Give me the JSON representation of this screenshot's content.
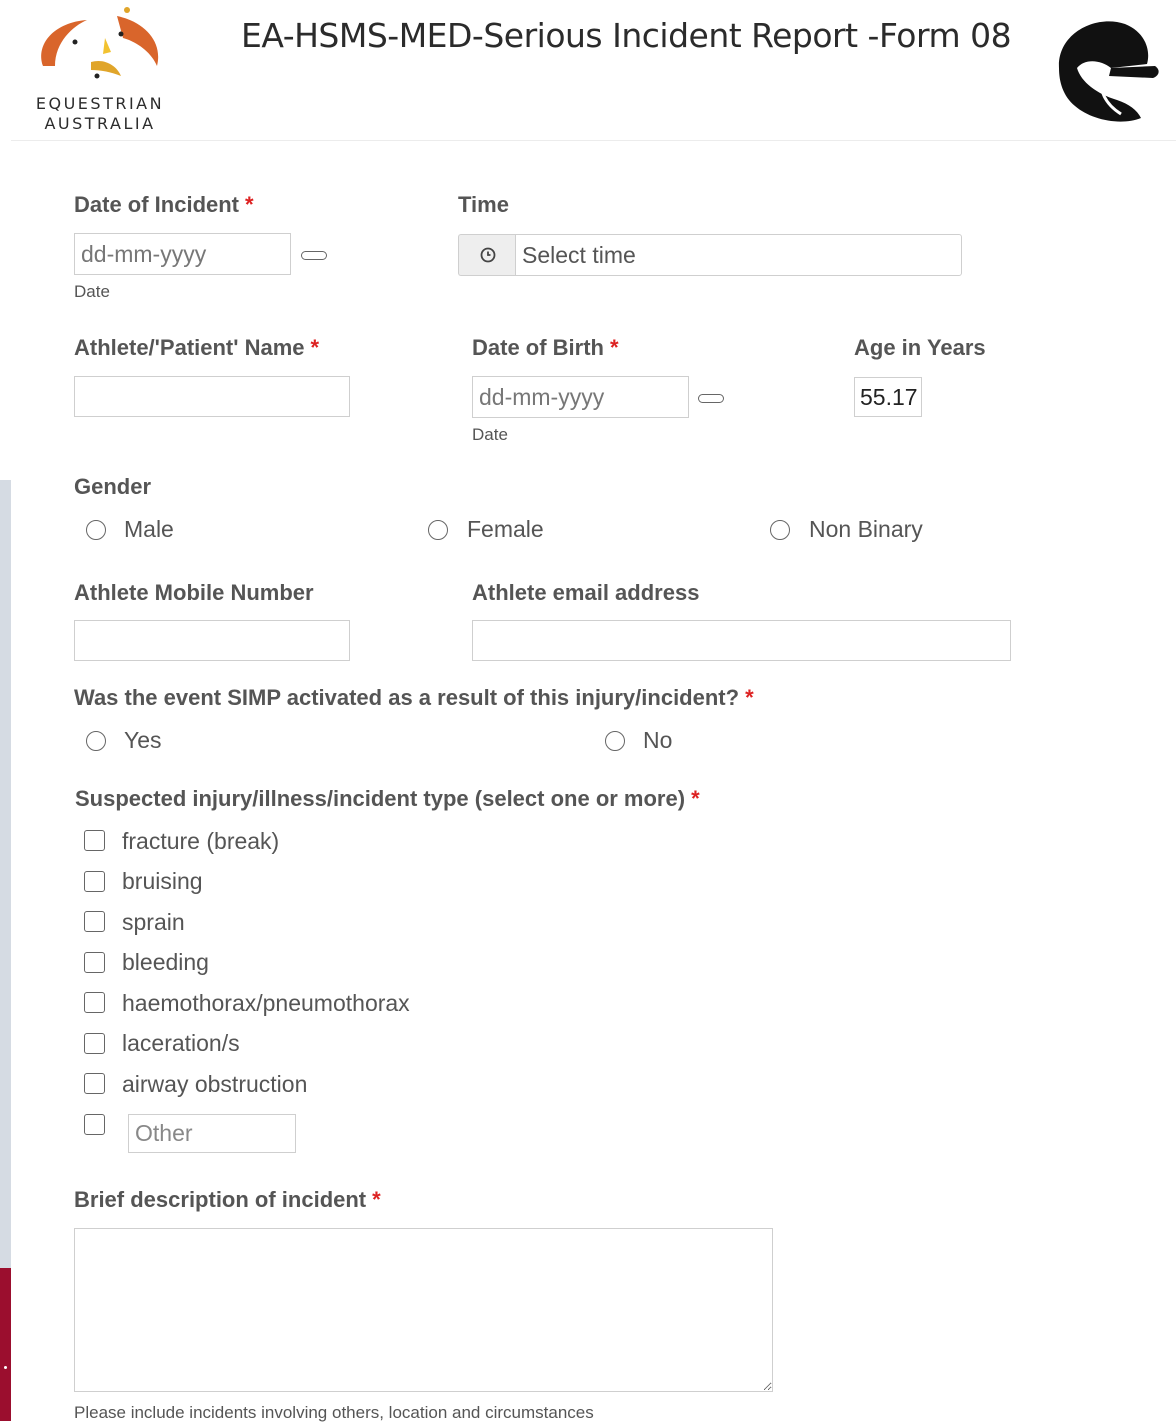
{
  "header": {
    "logo_line1": "EQUESTRIAN",
    "logo_line2": "AUSTRALIA",
    "title": "EA-HSMS-MED-Serious Incident Report  -Form 08"
  },
  "colors": {
    "required": "#dd2222",
    "brand_red": "#9b0e2e",
    "logo_orange": "#d9652b",
    "logo_yellow": "#f2c230"
  },
  "fields": {
    "date_of_incident": {
      "label": "Date of Incident",
      "placeholder": "dd-mm-yyyy",
      "hint": "Date"
    },
    "time": {
      "label": "Time",
      "placeholder": "Select time",
      "icon": "clock-icon"
    },
    "patient_name": {
      "label": "Athlete/'Patient' Name"
    },
    "date_of_birth": {
      "label": "Date of Birth",
      "placeholder": "dd-mm-yyyy",
      "hint": "Date"
    },
    "age_in_years": {
      "label": "Age in Years",
      "value": "55.17"
    },
    "gender": {
      "label": "Gender",
      "options": [
        "Male",
        "Female",
        "Non Binary"
      ]
    },
    "mobile": {
      "label": "Athlete Mobile Number"
    },
    "email": {
      "label": "Athlete email address"
    },
    "simp": {
      "label": "Was the event SIMP activated as a result of this injury/incident?",
      "options": [
        "Yes",
        "No"
      ]
    },
    "injury_type": {
      "label": "Suspected injury/illness/incident type (select one or more)",
      "options": [
        "fracture (break)",
        "bruising",
        "sprain",
        "bleeding",
        "haemothorax/pneumothorax",
        "laceration/s",
        "airway obstruction"
      ],
      "other_placeholder": "Other"
    },
    "description": {
      "label": "Brief description of incident",
      "hint": "Please include incidents involving others, location and circumstances"
    }
  },
  "required_mark": "*"
}
